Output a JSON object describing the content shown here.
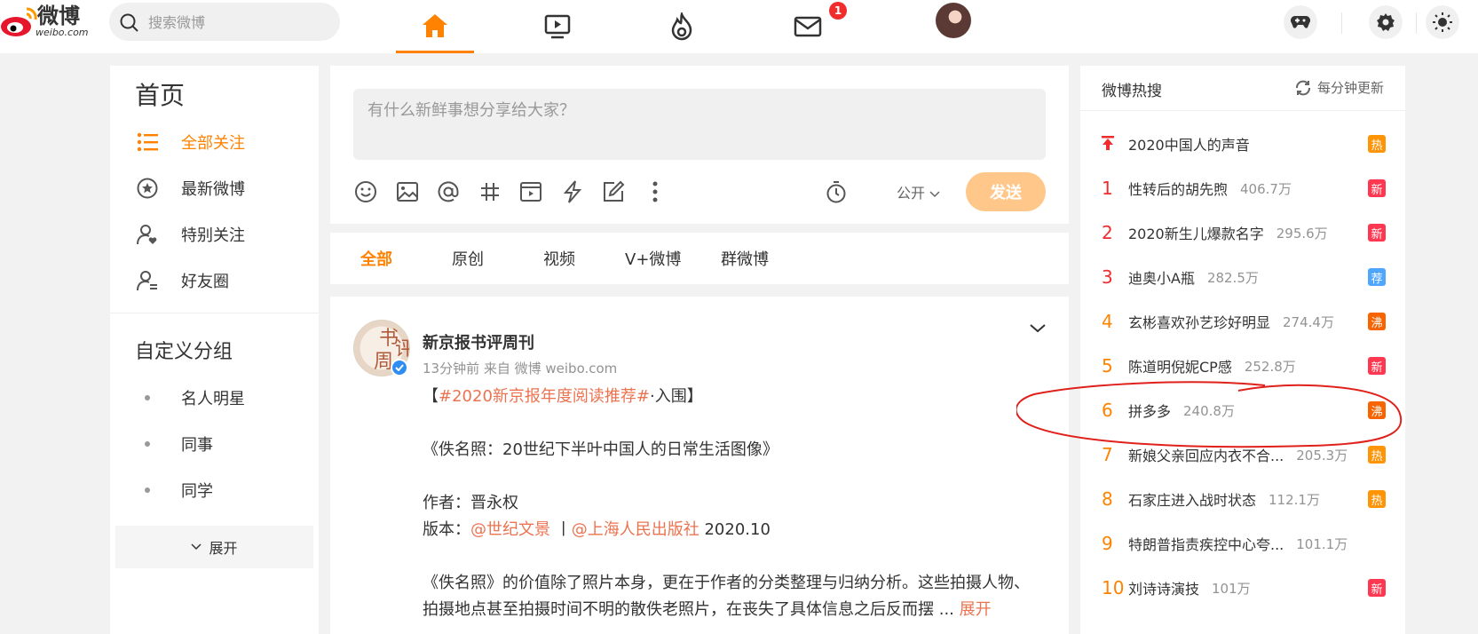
{
  "header": {
    "logo_text": "微博",
    "logo_sub": "weibo.com",
    "search_placeholder": "搜索微博",
    "message_badge": "1"
  },
  "leftnav": {
    "title": "首页",
    "items": [
      {
        "label": "全部关注",
        "icon": "list-icon",
        "active": true
      },
      {
        "label": "最新微博",
        "icon": "clock-star-icon"
      },
      {
        "label": "特别关注",
        "icon": "user-heart-icon"
      },
      {
        "label": "好友圈",
        "icon": "user-group-icon"
      }
    ],
    "group_title": "自定义分组",
    "groups": [
      "名人明星",
      "同事",
      "同学"
    ],
    "expand_label": "展开"
  },
  "composer": {
    "placeholder": "有什么新鲜事想分享给大家？",
    "visibility": "公开",
    "send_label": "发送"
  },
  "tabs": [
    "全部",
    "原创",
    "视频",
    "V+微博",
    "群微博"
  ],
  "post": {
    "author": "新京报书评周刊",
    "avatar_text": [
      "书",
      "评",
      "周",
      "刊"
    ],
    "meta": "13分钟前 来自 微博 weibo.com",
    "hashtag": "#2020新京报年度阅读推荐#",
    "line1_prefix": "【",
    "line1_suffix": "·入围】",
    "line2": "《佚名照：20世纪下半叶中国人的日常生活图像》",
    "line3": "作者：晋永权",
    "line4_prefix": "版本：",
    "publisher1": "@世纪文景",
    "separator": " 丨",
    "publisher2": "@上海人民出版社",
    "line4_suffix": " 2020.10",
    "line5": "《佚名照》的价值除了照片本身，更在于作者的分类整理与归纳分析。这些拍摄人物、",
    "line6": "拍摄地点甚至拍摄时间不明的散佚老照片，在丧失了具体信息之后反而摆 ...",
    "expand": "展开"
  },
  "hotsearch": {
    "title": "微博热搜",
    "refresh": "每分钟更新",
    "items": [
      {
        "rank": "",
        "text": "2020中国人的声音",
        "count": "",
        "badge": "热",
        "badge_color": "#ff9406"
      },
      {
        "rank": "1",
        "text": "性转后的胡先煦",
        "count": "406.7万",
        "badge": "新",
        "badge_color": "#ff3852"
      },
      {
        "rank": "2",
        "text": "2020新生儿爆款名字",
        "count": "295.6万",
        "badge": "新",
        "badge_color": "#ff3852"
      },
      {
        "rank": "3",
        "text": "迪奥小A瓶",
        "count": "282.5万",
        "badge": "荐",
        "badge_color": "#4fa6ff"
      },
      {
        "rank": "4",
        "text": "玄彬喜欢孙艺珍好明显",
        "count": "274.4万",
        "badge": "沸",
        "badge_color": "#f86400"
      },
      {
        "rank": "5",
        "text": "陈道明倪妮CP感",
        "count": "252.8万",
        "badge": "新",
        "badge_color": "#ff3852"
      },
      {
        "rank": "6",
        "text": "拼多多",
        "count": "240.8万",
        "badge": "沸",
        "badge_color": "#f86400"
      },
      {
        "rank": "7",
        "text": "新娘父亲回应内衣不合...",
        "count": "205.3万",
        "badge": "热",
        "badge_color": "#ff9406"
      },
      {
        "rank": "8",
        "text": "石家庄进入战时状态",
        "count": "112.1万",
        "badge": "热",
        "badge_color": "#ff9406"
      },
      {
        "rank": "9",
        "text": "特朗普指责疾控中心夸...",
        "count": "101.1万",
        "badge": "",
        "badge_color": ""
      },
      {
        "rank": "10",
        "text": "刘诗诗演技",
        "count": "101万",
        "badge": "新",
        "badge_color": "#ff3852"
      }
    ]
  },
  "colors": {
    "accent": "#ff8200",
    "link": "#eb7350",
    "send_disabled": "#ffc78a",
    "annotation": "#e0201a"
  }
}
